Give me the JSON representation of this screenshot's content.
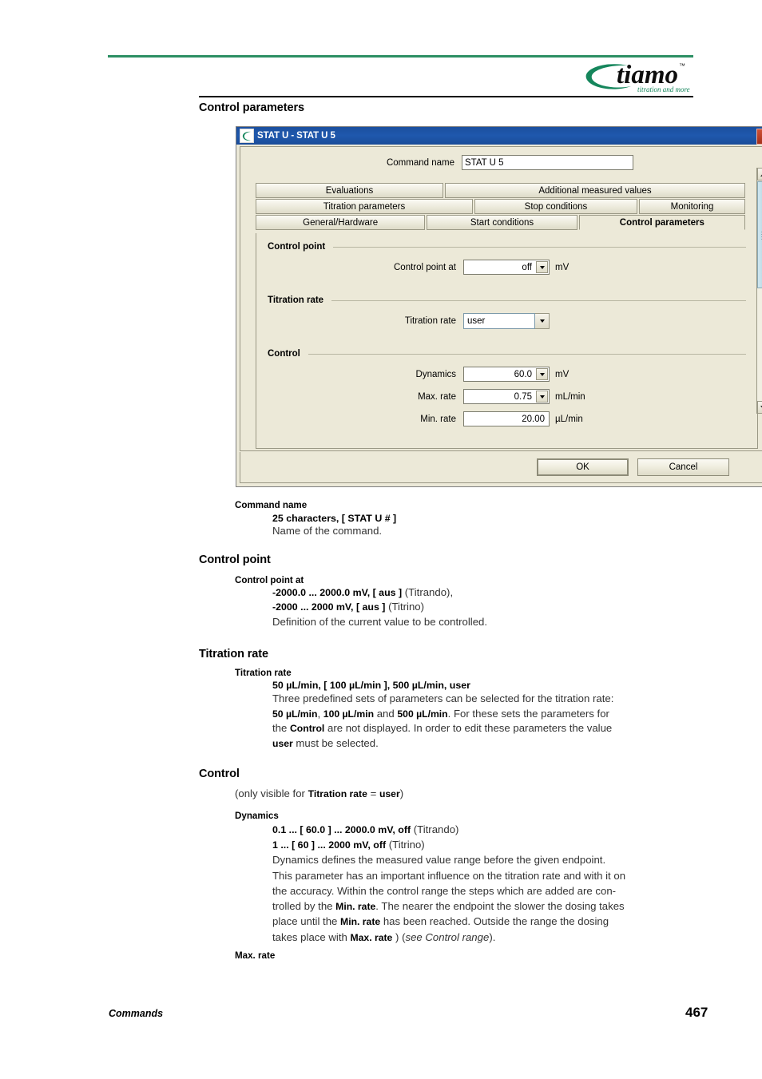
{
  "header": {
    "logo_wordmark": "tiamo",
    "logo_tm": "™",
    "logo_tagline": "titration and more",
    "rule_green_color": "#2c8f63"
  },
  "headings": {
    "control_parameters": "Control parameters",
    "control_point": "Control point",
    "titration_rate": "Titration rate",
    "control": "Control"
  },
  "dialog": {
    "title": "STAT U - STAT U 5",
    "close_label": "✕",
    "command_name": {
      "label": "Command name",
      "value": "STAT U 5"
    },
    "tabs": [
      {
        "label": "Evaluations",
        "selected": false
      },
      {
        "label": "Additional measured values",
        "selected": false
      },
      {
        "label": "Titration parameters",
        "selected": false
      },
      {
        "label": "Stop conditions",
        "selected": false
      },
      {
        "label": "Monitoring",
        "selected": false
      },
      {
        "label": "General/Hardware",
        "selected": false
      },
      {
        "label": "Start conditions",
        "selected": false
      },
      {
        "label": "Control parameters",
        "selected": true
      }
    ],
    "groups": [
      {
        "title": "Control point",
        "fields": [
          {
            "label": "Control point at",
            "value": "off",
            "unit": "mV",
            "kind": "spin"
          }
        ]
      },
      {
        "title": "Titration rate",
        "fields": [
          {
            "label": "Titration rate",
            "value": "user",
            "unit": "",
            "kind": "combo"
          }
        ]
      },
      {
        "title": "Control",
        "fields": [
          {
            "label": "Dynamics",
            "value": "60.0",
            "unit": "mV",
            "kind": "spin"
          },
          {
            "label": "Max. rate",
            "value": "0.75",
            "unit": "mL/min",
            "kind": "spin"
          },
          {
            "label": "Min. rate",
            "value": "20.00",
            "unit": "µL/min",
            "kind": "text"
          }
        ]
      }
    ],
    "buttons": {
      "ok": "OK",
      "cancel": "Cancel"
    }
  },
  "body": {
    "command_name": {
      "term": "Command name",
      "range": "25 characters, [ STAT U # ]",
      "desc": "Name of the command."
    },
    "control_point_at": {
      "term": "Control point at",
      "range1_bold": "-2000.0 ... 2000.0 mV, [ aus ]",
      "range1_plain": " (Titrando),",
      "range2_bold": "-2000 ... 2000 mV, [ aus ]",
      "range2_plain": " (Titrino)",
      "desc": "Definition of the current value to be controlled."
    },
    "titration_rate": {
      "term": "Titration rate",
      "range": "50 µL/min, [ 100 µL/min ], 500 µL/min, user",
      "desc_line1": "Three predefined sets of parameters can be selected for the titration rate:",
      "desc_line2_a": "50 µL/min",
      "desc_line2_b": ", ",
      "desc_line2_c": "100 µL/min",
      "desc_line2_d": " and ",
      "desc_line2_e": "500 µL/min",
      "desc_line2_f": ". For these sets the parameters for",
      "desc_line3_a": "the ",
      "desc_line3_b": "Control",
      "desc_line3_c": " are not displayed. In order to edit these parameters the value",
      "desc_line4_a": "user",
      "desc_line4_b": " must be selected."
    },
    "control": {
      "note_a": "(only visible for ",
      "note_b": "Titration rate",
      "note_c": " = ",
      "note_d": "user",
      "note_e": ")",
      "dynamics_term": "Dynamics",
      "dynamics_range1_bold": "0.1 ... [ 60.0 ] ... 2000.0 mV, off",
      "dynamics_range1_plain": " (Titrando)",
      "dynamics_range2_bold": "1 ... [ 60 ] ... 2000 mV, off",
      "dynamics_range2_plain": " (Titrino)",
      "desc_l1": "Dynamics defines the measured value range before the given endpoint.",
      "desc_l2": "This parameter has an important influence on the titration rate and with it on",
      "desc_l3": "the accuracy. Within the control range the steps which are added are con-",
      "desc_l4_a": "trolled by the ",
      "desc_l4_b": "Min. rate",
      "desc_l4_c": ". The nearer the endpoint the slower the dosing takes",
      "desc_l5_a": "place until the ",
      "desc_l5_b": "Min. rate",
      "desc_l5_c": " has been reached. Outside the range the dosing",
      "desc_l6_a": "takes place with ",
      "desc_l6_b": "Max. rate",
      "desc_l6_c": " ) (",
      "desc_l6_d": "see Control range",
      "desc_l6_e": ").",
      "max_rate_term": "Max. rate"
    }
  },
  "footer": {
    "chapter": "Commands",
    "page_number": "467"
  }
}
